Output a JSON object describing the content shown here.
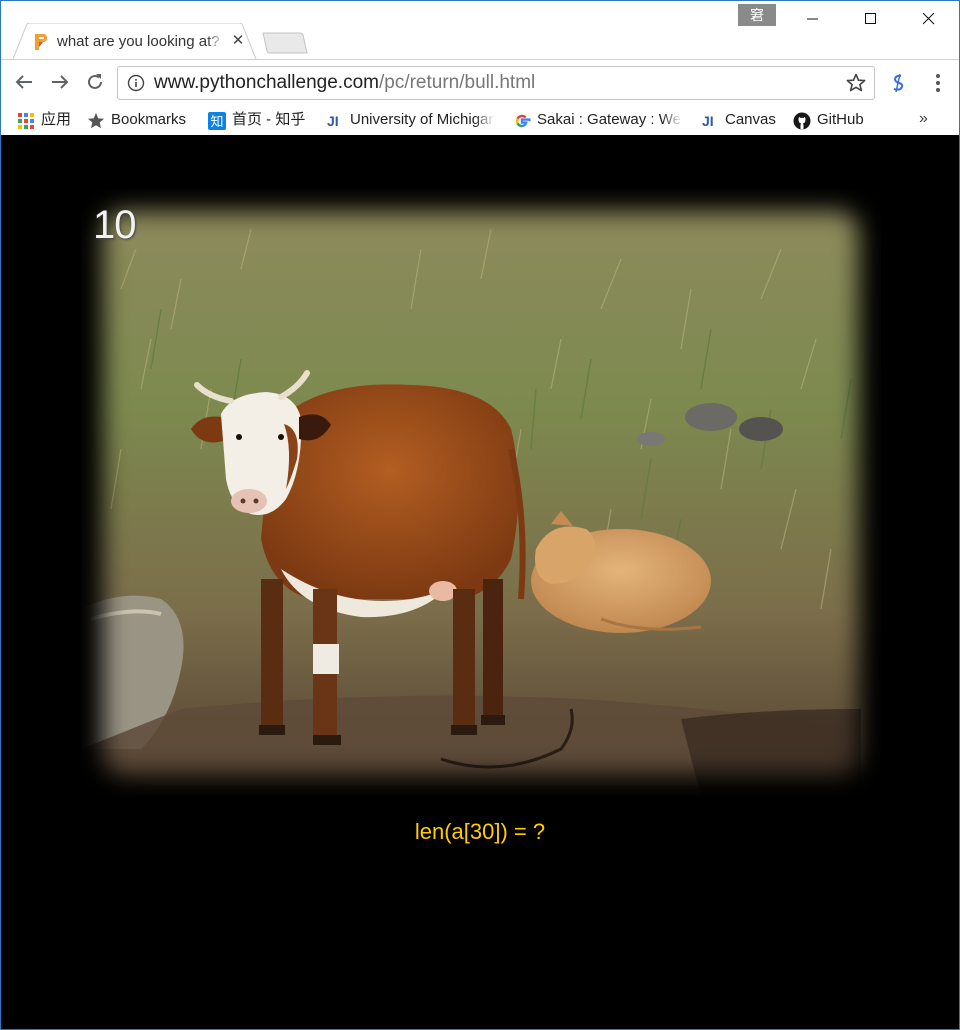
{
  "window": {
    "profile_badge": "窘",
    "accent_color": "#2b78c5"
  },
  "tab": {
    "title": "what are you looking at?",
    "favicon": "pythonchallenge-icon",
    "close_glyph": "✕"
  },
  "toolbar": {
    "url_host": "www.pythonchallenge.com",
    "url_path": "/pc/return/bull.html"
  },
  "bookmarks": {
    "items": [
      {
        "label": "应用",
        "icon": "apps-grid-icon"
      },
      {
        "label": "Bookmarks",
        "icon": "star-icon"
      },
      {
        "label": "首页 - 知乎",
        "icon": "zhihu-icon"
      },
      {
        "label": "University of Michigan",
        "icon": "ji-icon"
      },
      {
        "label": "Sakai : Gateway : Welcome",
        "icon": "google-icon"
      },
      {
        "label": "Canvas",
        "icon": "ji-icon"
      },
      {
        "label": "GitHub",
        "icon": "github-icon"
      }
    ],
    "more": "»"
  },
  "page": {
    "background": "#000000",
    "image_number": "10",
    "caption": "len(a[30]) = ?",
    "caption_color": "#ffcc00"
  }
}
